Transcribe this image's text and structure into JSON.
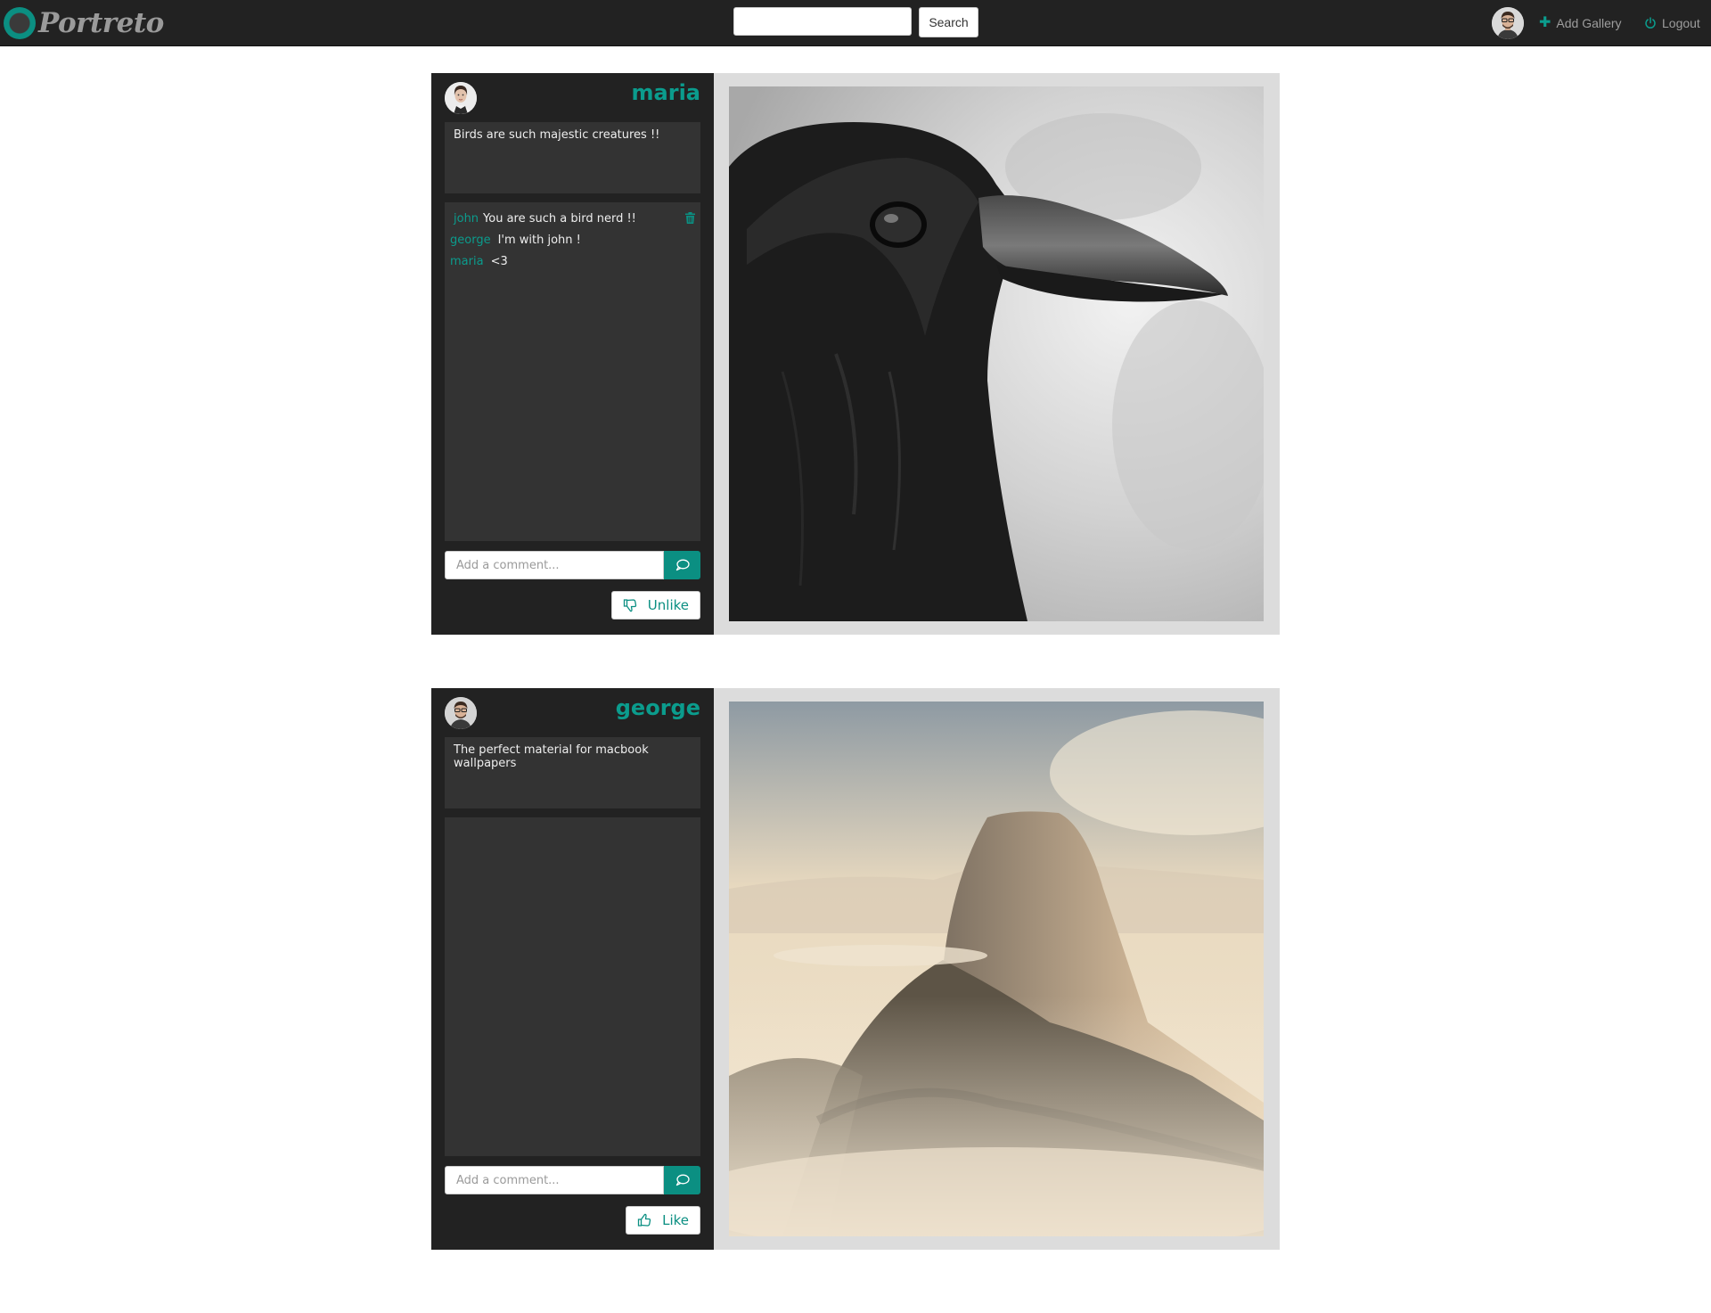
{
  "navbar": {
    "brand": "Portreto",
    "search_placeholder": "",
    "search_button": "Search",
    "add_gallery": "Add Gallery",
    "logout": "Logout"
  },
  "accent_color": "#0b8f82",
  "galleries": [
    {
      "username": "maria",
      "description": "Birds are such majestic creatures !!",
      "comments": [
        {
          "author": "john",
          "text": "You are such a bird nerd !!"
        },
        {
          "author": "george",
          "text": "I'm with john !"
        },
        {
          "author": "maria",
          "text": "<3"
        }
      ],
      "comment_placeholder": "Add a comment...",
      "like_label": "Unlike",
      "like_icon": "thumbs-down-icon",
      "photo": "crow-closeup"
    },
    {
      "username": "george",
      "description": "The perfect material for macbook wallpapers",
      "comments": [],
      "comment_placeholder": "Add a comment...",
      "like_label": "Like",
      "like_icon": "thumbs-up-icon",
      "photo": "half-dome-mountain-in-fog"
    }
  ]
}
